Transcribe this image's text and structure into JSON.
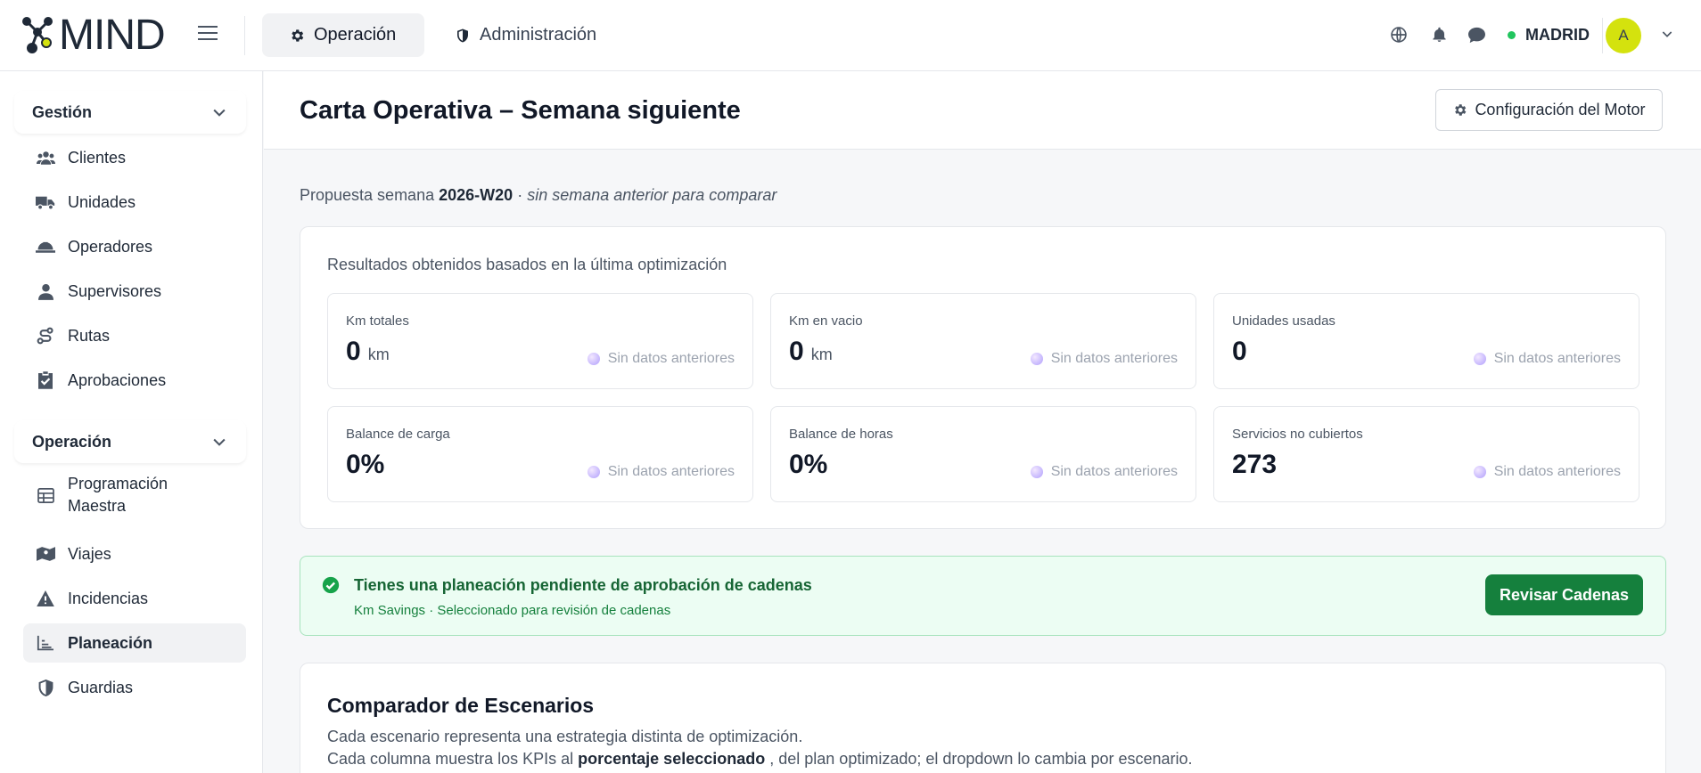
{
  "app": {
    "logo_text": "MIND"
  },
  "topnav": {
    "tabs": [
      {
        "label": "Operación",
        "icon": "gear-icon",
        "active": true
      },
      {
        "label": "Administración",
        "icon": "shield-icon",
        "active": false
      }
    ],
    "icons": [
      "globe-icon",
      "bell-icon",
      "chat-icon"
    ],
    "status_color": "#22c55e",
    "region": "MADRID",
    "avatar_initial": "A",
    "avatar_color": "#d4e20e"
  },
  "sidebar": {
    "sections": [
      {
        "title": "Gestión",
        "items": [
          {
            "label": "Clientes",
            "icon": "users-icon"
          },
          {
            "label": "Unidades",
            "icon": "truck-icon"
          },
          {
            "label": "Operadores",
            "icon": "hardhat-icon"
          },
          {
            "label": "Supervisores",
            "icon": "user-tie-icon"
          },
          {
            "label": "Rutas",
            "icon": "route-icon"
          },
          {
            "label": "Aprobaciones",
            "icon": "clipboard-check-icon"
          }
        ]
      },
      {
        "title": "Operación",
        "items": [
          {
            "label": "Programación Maestra",
            "icon": "table-icon"
          },
          {
            "label": "Viajes",
            "icon": "map-icon"
          },
          {
            "label": "Incidencias",
            "icon": "warning-icon"
          },
          {
            "label": "Planeación",
            "icon": "chart-line-icon",
            "active": true
          },
          {
            "label": "Guardias",
            "icon": "shield-half-icon"
          }
        ]
      }
    ]
  },
  "page": {
    "title": "Carta Operativa – Semana siguiente",
    "config_button": "Configuración del Motor",
    "proposal_prefix": "Propuesta semana",
    "proposal_week": "2026-W20",
    "proposal_sep": "·",
    "proposal_note": "sin semana anterior para comparar"
  },
  "results": {
    "title": "Resultados obtenidos basados en la última optimización",
    "kpis": [
      {
        "label": "Km totales",
        "value": "0",
        "unit": "km",
        "prev": "Sin datos anteriores"
      },
      {
        "label": "Km en vacio",
        "value": "0",
        "unit": "km",
        "prev": "Sin datos anteriores"
      },
      {
        "label": "Unidades usadas",
        "value": "0",
        "unit": "",
        "prev": "Sin datos anteriores"
      },
      {
        "label": "Balance de carga",
        "value": "0%",
        "unit": "",
        "prev": "Sin datos anteriores"
      },
      {
        "label": "Balance de horas",
        "value": "0%",
        "unit": "",
        "prev": "Sin datos anteriores"
      },
      {
        "label": "Servicios no cubiertos",
        "value": "273",
        "unit": "",
        "prev": "Sin datos anteriores"
      }
    ]
  },
  "alert": {
    "title": "Tienes una planeación pendiente de aprobación de cadenas",
    "subtitle": "Km Savings · Seleccionado para revisión de cadenas",
    "button": "Revisar Cadenas",
    "color": "#15803d"
  },
  "scenarios": {
    "title": "Comparador de Escenarios",
    "desc1": "Cada escenario representa una estrategia distinta de optimización.",
    "desc2_prefix": "Cada columna muestra los KPIs al",
    "desc2_bold": "porcentaje seleccionado",
    "desc2_suffix": ", del plan optimizado; el dropdown lo cambia por escenario."
  }
}
